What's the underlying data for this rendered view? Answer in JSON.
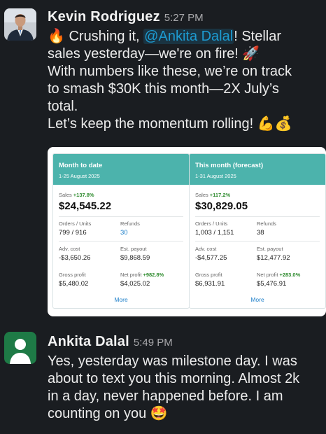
{
  "messages": [
    {
      "author": "Kevin Rodriguez",
      "time": "5:27 PM",
      "line1_pre": "🔥 Crushing it, ",
      "mention": "@Ankita Dalal",
      "line1_post": "! Stellar",
      "line2": "sales yesterday—we're on fire! 🚀",
      "line3": "With numbers like these, we’re on track",
      "line4": "to smash $30K this month—2X July’s",
      "line5": "total.",
      "line6": "Let’s keep the momentum rolling! 💪💰",
      "cards": [
        {
          "title": "Month to date",
          "range": "1-25 August 2025",
          "sales_label": "Sales",
          "sales_pct": "+137.8%",
          "sales_value": "$24,545.22",
          "orders_label": "Orders / Units",
          "orders_value": "799 / 916",
          "refunds_label": "Refunds",
          "refunds_value": "30",
          "adv_label": "Adv. cost",
          "adv_value": "-$3,650.26",
          "payout_label": "Est. payout",
          "payout_value": "$9,868.59",
          "gross_label": "Gross profit",
          "gross_value": "$5,480.02",
          "net_label": "Net profit",
          "net_pct": "+982.8%",
          "net_value": "$4,025.02",
          "more": "More"
        },
        {
          "title": "This month (forecast)",
          "range": "1-31 August 2025",
          "sales_label": "Sales",
          "sales_pct": "+117.2%",
          "sales_value": "$30,829.05",
          "orders_label": "Orders / Units",
          "orders_value": "1,003 / 1,151",
          "refunds_label": "Refunds",
          "refunds_value": "38",
          "adv_label": "Adv. cost",
          "adv_value": "-$4,577.25",
          "payout_label": "Est. payout",
          "payout_value": "$12,477.92",
          "gross_label": "Gross profit",
          "gross_value": "$6,931.91",
          "net_label": "Net profit",
          "net_pct": "+283.0%",
          "net_value": "$5,476.91",
          "more": "More"
        }
      ]
    },
    {
      "author": "Ankita Dalal",
      "time": "5:49 PM",
      "line1": "Yes, yesterday was milestone day. I was",
      "line2": "about to text you this morning. Almost 2k",
      "line3": "in a day, never happened before. I am",
      "line4": "counting on you 🤩"
    }
  ],
  "colors": {
    "background": "#1a1d21",
    "card_header": "#4cb3ac",
    "mention": "#1d9bd1",
    "link": "#1d7fc9",
    "positive": "#2e8b2e",
    "avatar2": "#1e7a46"
  }
}
